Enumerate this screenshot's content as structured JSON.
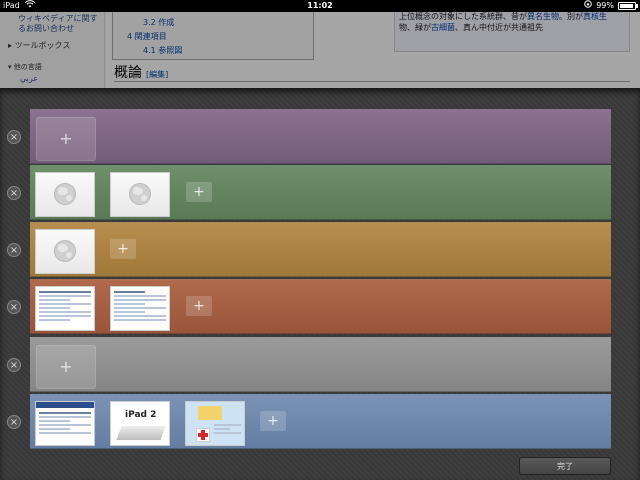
{
  "status_bar": {
    "device": "iPad",
    "wifi_icon": "wifi-icon",
    "time": "11:02",
    "orientation_icon": "orientation-lock-icon",
    "battery_percent": "99%",
    "battery_level": 0.99
  },
  "background_page": {
    "sidebar": {
      "contact": "ウィキペディアに関するお問い合わせ",
      "toolbox": "ツールボックス",
      "languages": "他の言語",
      "arabic_link": "عربي"
    },
    "toc": {
      "item_32": "3.2 作成",
      "item_4": "4 関連項目",
      "item_41": "4.1 参照図"
    },
    "infobox": {
      "line1_prefix": "上位概念の対象にした系統群、昔が",
      "line1_link": "異名生物",
      "line1_mid": "。別が",
      "line1_link2": "真核生",
      "line2_prefix": "物、緑が",
      "line2_link": "古細菌",
      "line2_suffix": "、真ん中付近が共通祖先"
    },
    "heading": "概論",
    "edit_link": "[編集]"
  },
  "tab_groups": {
    "add_label": "+",
    "close_label": "×",
    "rows": [
      {
        "color": "#7f6885",
        "tabs": []
      },
      {
        "color": "#658562",
        "tabs": [
          "globe",
          "globe"
        ]
      },
      {
        "color": "#ad8343",
        "tabs": [
          "globe"
        ]
      },
      {
        "color": "#a45f43",
        "tabs": [
          "wiki-page",
          "wiki-page"
        ]
      },
      {
        "color": "#8f8f8f",
        "tabs": []
      },
      {
        "color": "#6e88ab",
        "tabs": [
          "news-page",
          "ipad2-page",
          "redcross-page"
        ]
      }
    ],
    "ipad2_thumb_text": "iPad 2"
  },
  "done_button": "完了"
}
